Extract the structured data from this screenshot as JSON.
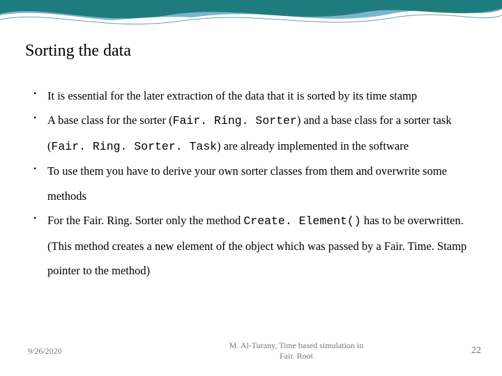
{
  "slide": {
    "title": "Sorting the data",
    "bullets": [
      {
        "pre": "It is essential for the later extraction of the data that it is sorted by its time stamp"
      },
      {
        "pre": "A base class for the sorter (",
        "code1": "Fair. Ring. Sorter",
        "mid1": ") and a base class for a sorter task (",
        "code2": "Fair. Ring. Sorter. Task",
        "mid2": ") are already implemented in the software"
      },
      {
        "pre": "To use them you have to derive your own sorter classes from them and overwrite some methods"
      },
      {
        "pre": "For the Fair. Ring. Sorter only the method ",
        "code1": "Create. Element()",
        "mid1": " has to be overwritten. (This method creates a new element of the object which was passed by a Fair. Time. Stamp pointer to the method)"
      }
    ]
  },
  "footer": {
    "date": "9/26/2020",
    "credit_line1": "M. Al-Turany, Time based simulation in",
    "credit_line2": "Fair. Root",
    "page": "22"
  }
}
